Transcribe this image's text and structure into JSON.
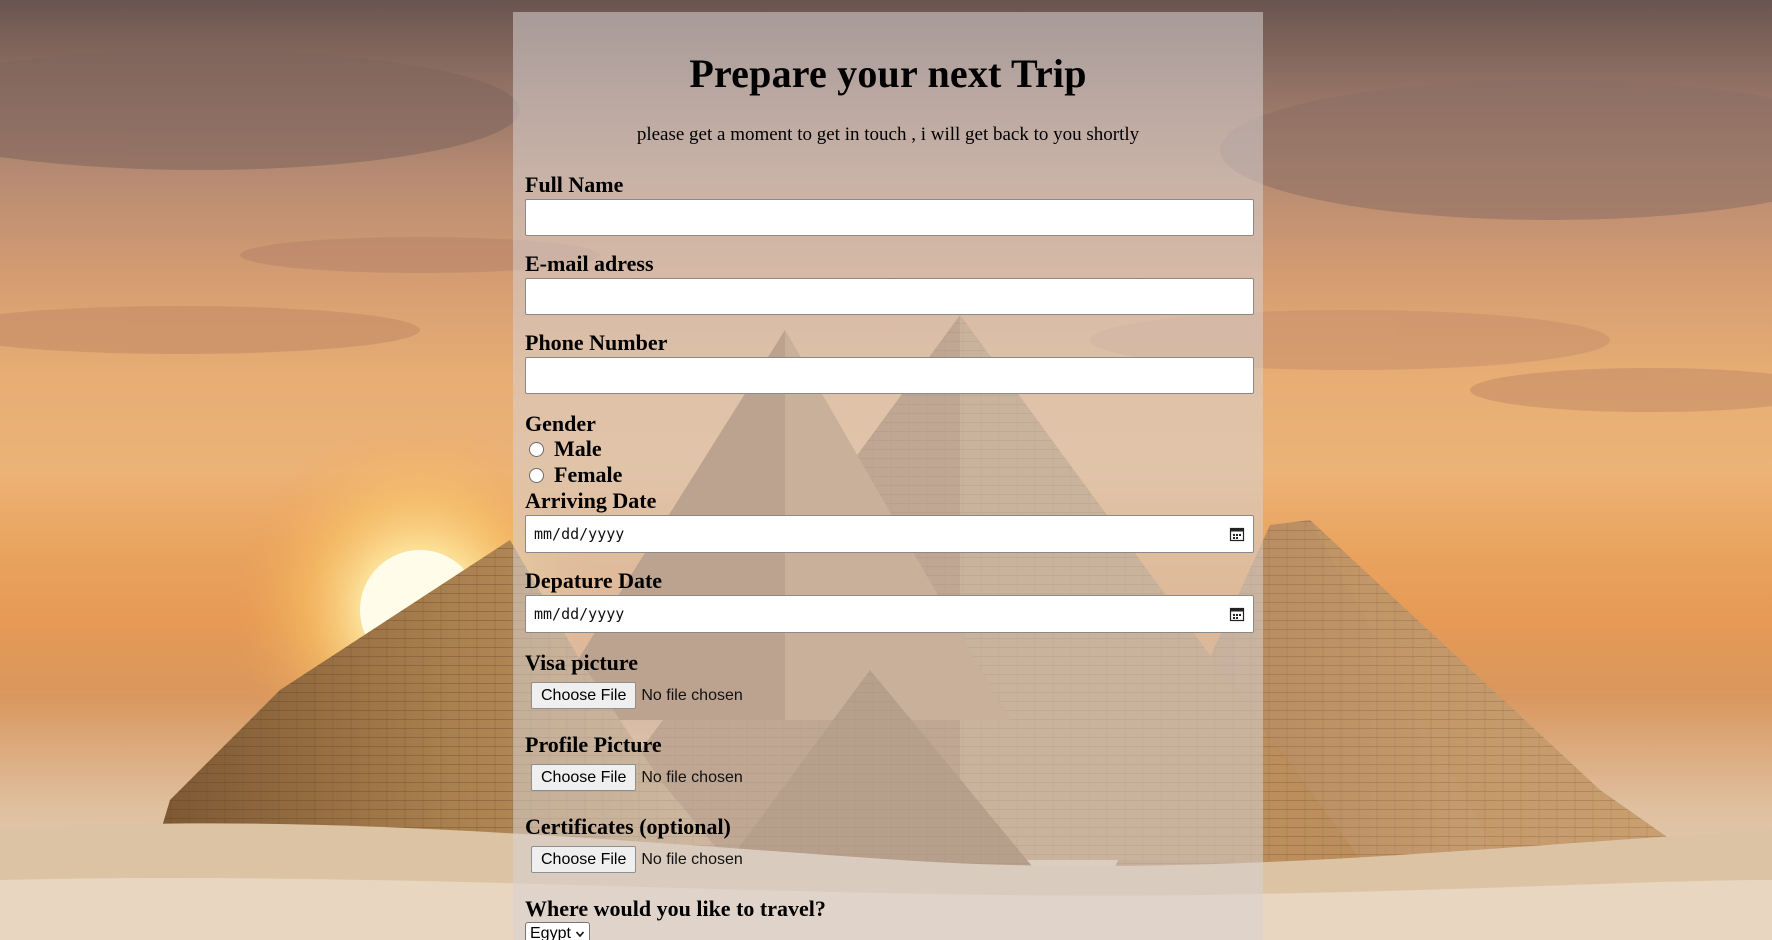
{
  "form": {
    "title": "Prepare your next Trip",
    "subtitle": "please get a moment to get in touch , i will get back to you shortly",
    "full_name": {
      "label": "Full Name",
      "value": "",
      "placeholder": ""
    },
    "email": {
      "label": "E-mail adress",
      "value": "",
      "placeholder": ""
    },
    "phone": {
      "label": "Phone Number",
      "value": "",
      "placeholder": ""
    },
    "gender": {
      "label": "Gender",
      "options": [
        "Male",
        "Female"
      ]
    },
    "arriving_date": {
      "label": "Arriving Date",
      "value": "mm/dd/yyyy"
    },
    "departure_date": {
      "label": "Depature Date",
      "value": "mm/dd/yyyy"
    },
    "visa_picture": {
      "label": "Visa picture",
      "button": "Choose File",
      "status": "No file chosen"
    },
    "profile_picture": {
      "label": "Profile Picture",
      "button": "Choose File",
      "status": "No file chosen"
    },
    "certificates": {
      "label": "Certificates (optional)",
      "button": "Choose File",
      "status": "No file chosen"
    },
    "destination": {
      "label": "Where would you like to travel?",
      "selected": "Egypt"
    }
  },
  "colors": {
    "panel_overlay": "#d7d2d2",
    "sky_top": "#6a5450",
    "sky_mid": "#e7ad74",
    "sand": "#e6d3bf"
  }
}
